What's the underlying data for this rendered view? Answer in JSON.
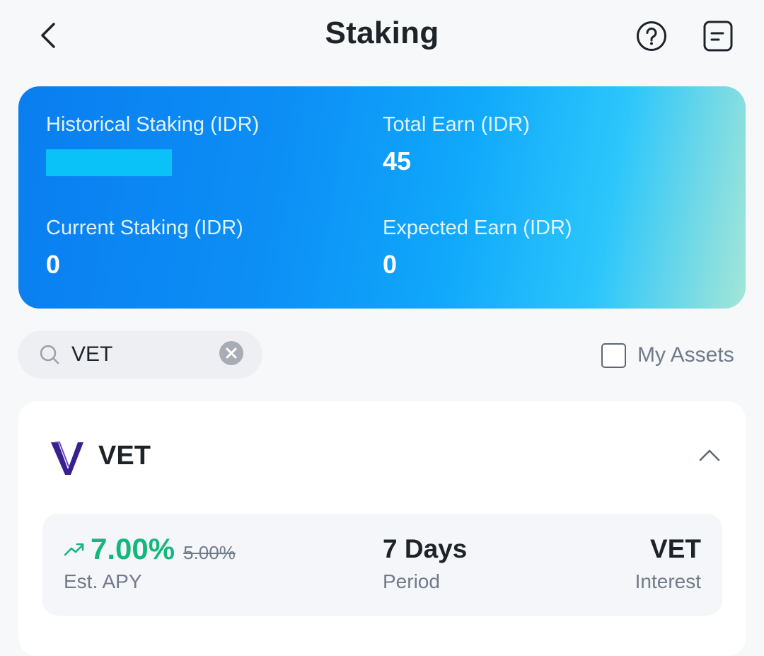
{
  "header": {
    "title": "Staking",
    "icons": {
      "back": "chevron-left-icon",
      "help": "question-circle-icon",
      "records": "document-list-icon"
    }
  },
  "summary": {
    "historical_staking": {
      "label": "Historical Staking (IDR)",
      "value": ""
    },
    "total_earn": {
      "label": "Total Earn (IDR)",
      "value": "45"
    },
    "current_staking": {
      "label": "Current Staking (IDR)",
      "value": "0"
    },
    "expected_earn": {
      "label": "Expected Earn (IDR)",
      "value": "0"
    },
    "gradient_colors": [
      "#0a7ef0",
      "#10a8fb",
      "#a4e6d7"
    ]
  },
  "search": {
    "value": "VET",
    "placeholder": "",
    "icons": {
      "search": "search-icon",
      "clear": "clear-circle-icon"
    }
  },
  "filter": {
    "my_assets_label": "My Assets",
    "my_assets_checked": false
  },
  "product": {
    "coin": "VET",
    "logo_icon": "vechain-logo",
    "expanded": true,
    "apy": {
      "value": "7.00%",
      "old_value": "5.00%",
      "label": "Est. APY",
      "trend_icon": "trending-up-icon",
      "color": "#13b77c"
    },
    "period": {
      "value": "7 Days",
      "label": "Period"
    },
    "interest": {
      "value": "VET",
      "label": "Interest"
    }
  }
}
